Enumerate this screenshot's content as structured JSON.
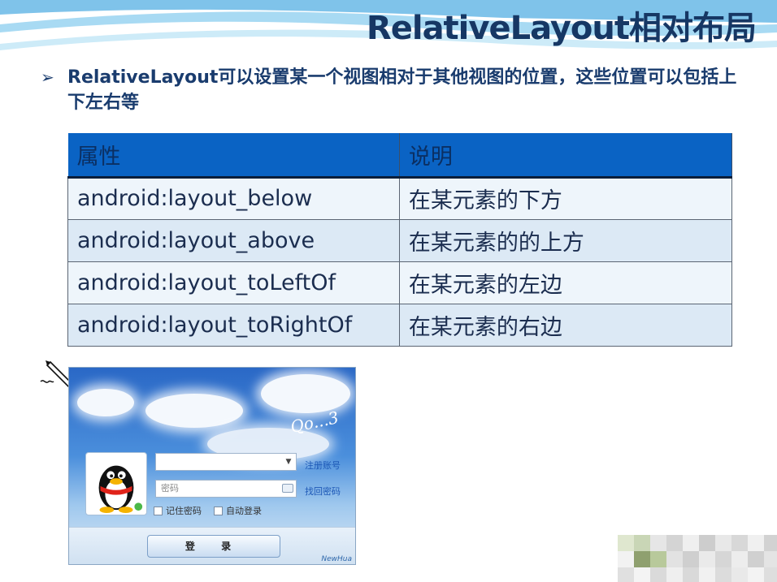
{
  "slide": {
    "title": "RelativeLayout相对布局",
    "bullet": "RelativeLayout可以设置某一个视图相对于其他视图的位置，这些位置可以包括上下左右等",
    "bullet_marker": "➢"
  },
  "table": {
    "headers": [
      "属性",
      "说明"
    ],
    "rows": [
      {
        "attr": "android:layout_below",
        "desc": "在某元素的下方"
      },
      {
        "attr": "android:layout_above",
        "desc": "在某元素的的上方"
      },
      {
        "attr": "android:layout_toLeftOf",
        "desc": "在某元素的左边"
      },
      {
        "attr": "android:layout_toRightOf",
        "desc": "在某元素的右边"
      }
    ]
  },
  "login_screenshot": {
    "signature": "Qo...3",
    "password_placeholder": "密码",
    "register_link": "注册账号",
    "recover_link": "找回密码",
    "remember_password": "记住密码",
    "auto_login": "自动登录",
    "login_button": "登 录",
    "brand": "NewHua"
  },
  "colors": {
    "header_blue": "#0a63c4",
    "title_navy": "#163764",
    "row_light": "#eef5fb"
  },
  "icons": {
    "bullet": "arrow-bullet-icon",
    "cursor": "pen-cursor-icon",
    "avatar": "penguin-avatar-icon"
  }
}
